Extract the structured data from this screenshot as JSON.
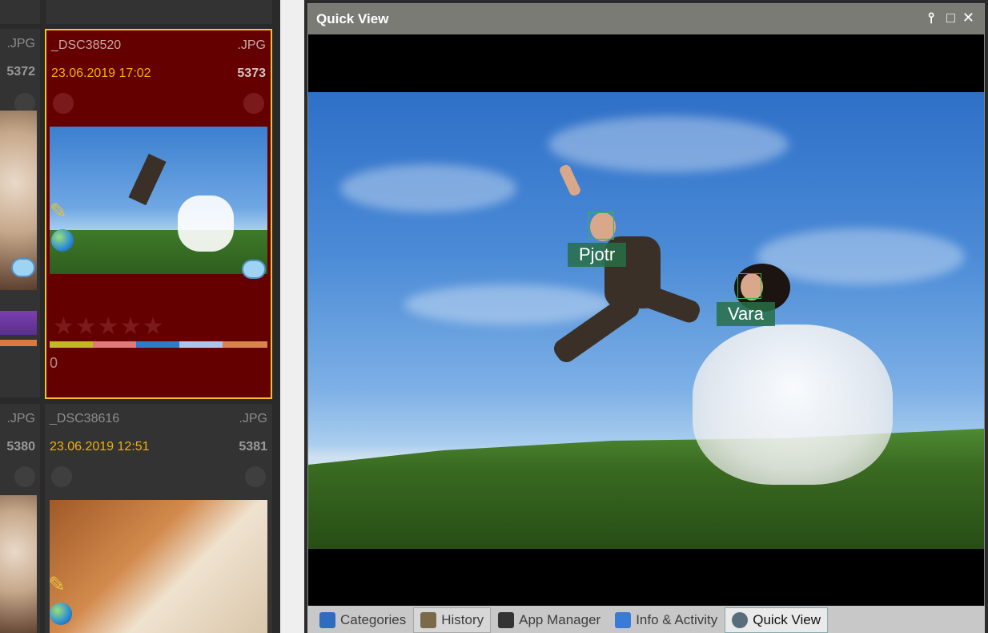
{
  "thumbnails": [
    {
      "name": "",
      "ext": ".JPG",
      "date": "",
      "number": "5372"
    },
    {
      "name": "_DSC38520",
      "ext": ".JPG",
      "date": "23.06.2019 17:02",
      "number": "5373",
      "selected": true,
      "rating_zero": "0"
    },
    {
      "name": "",
      "ext": ".JPG",
      "date": "",
      "number": "5380"
    },
    {
      "name": "_DSC38616",
      "ext": ".JPG",
      "date": "23.06.2019 12:51",
      "number": "5381"
    }
  ],
  "quick_view": {
    "title": "Quick View",
    "pin_glyph": "⫯",
    "max_glyph": "□",
    "close_glyph": "✕",
    "faces": [
      {
        "label": "Pjotr"
      },
      {
        "label": "Vara"
      }
    ]
  },
  "tabs": [
    {
      "label": "Categories",
      "icon": "categories-icon",
      "color": "#2f6cc0"
    },
    {
      "label": "History",
      "icon": "history-icon",
      "color": "#7a6a4a"
    },
    {
      "label": "App Manager",
      "icon": "app-manager-icon",
      "color": "#333333"
    },
    {
      "label": "Info & Activity",
      "icon": "info-icon",
      "color": "#3a7bd5"
    },
    {
      "label": "Quick View",
      "icon": "magnifier-icon",
      "color": "#5a6d7a"
    }
  ],
  "colors": {
    "selected_card": "#650000",
    "selected_border": "#f0c030",
    "date_text": "#f0b400",
    "face_label_bg": "#286e46"
  }
}
